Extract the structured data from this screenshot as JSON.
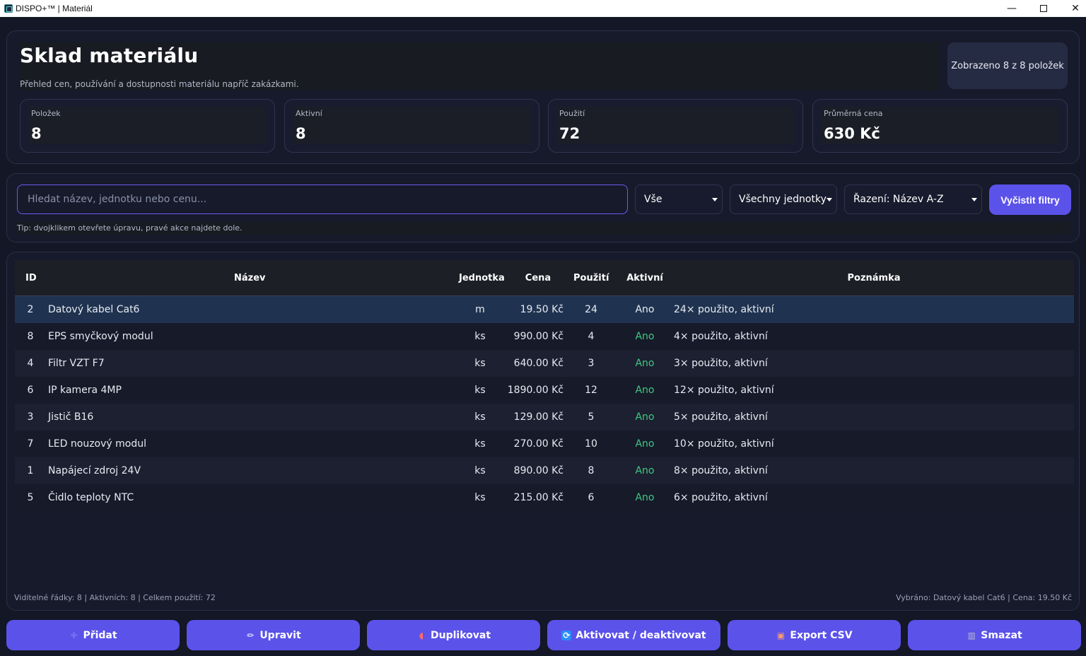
{
  "window": {
    "title": "DISPO+™ | Materiál"
  },
  "header": {
    "title": "Sklad materiálu",
    "subtitle": "Přehled cen, používání a dostupnosti materiálu napříč zakázkami.",
    "shown_badge": "Zobrazeno 8 z 8 položek",
    "stats": [
      {
        "label": "Položek",
        "value": "8"
      },
      {
        "label": "Aktivní",
        "value": "8"
      },
      {
        "label": "Použití",
        "value": "72"
      },
      {
        "label": "Průměrná cena",
        "value": "630 Kč"
      }
    ]
  },
  "filters": {
    "search_placeholder": "Hledat název, jednotku nebo cenu...",
    "search_value": "",
    "type_select": "Vše",
    "unit_select": "Všechny jednotky",
    "sort_select": "Řazení: Název A-Z",
    "clear_label": "Vyčistit filtry",
    "tip": "Tip: dvojklikem otevřete úpravu, pravé akce najdete dole."
  },
  "table": {
    "columns": [
      "ID",
      "Název",
      "Jednotka",
      "Cena",
      "Použití",
      "Aktivní",
      "Poznámka"
    ],
    "rows": [
      {
        "id": "2",
        "name": "Datový kabel Cat6",
        "unit": "m",
        "price": "19.50 Kč",
        "usage": "24",
        "active": "Ano",
        "note": "24× použito, aktivní"
      },
      {
        "id": "8",
        "name": "EPS smyčkový modul",
        "unit": "ks",
        "price": "990.00 Kč",
        "usage": "4",
        "active": "Ano",
        "note": "4× použito, aktivní"
      },
      {
        "id": "4",
        "name": "Filtr VZT F7",
        "unit": "ks",
        "price": "640.00 Kč",
        "usage": "3",
        "active": "Ano",
        "note": "3× použito, aktivní"
      },
      {
        "id": "6",
        "name": "IP kamera 4MP",
        "unit": "ks",
        "price": "1890.00 Kč",
        "usage": "12",
        "active": "Ano",
        "note": "12× použito, aktivní"
      },
      {
        "id": "3",
        "name": "Jistič B16",
        "unit": "ks",
        "price": "129.00 Kč",
        "usage": "5",
        "active": "Ano",
        "note": "5× použito, aktivní"
      },
      {
        "id": "7",
        "name": "LED nouzový modul",
        "unit": "ks",
        "price": "270.00 Kč",
        "usage": "10",
        "active": "Ano",
        "note": "10× použito, aktivní"
      },
      {
        "id": "1",
        "name": "Napájecí zdroj 24V",
        "unit": "ks",
        "price": "890.00 Kč",
        "usage": "8",
        "active": "Ano",
        "note": "8× použito, aktivní"
      },
      {
        "id": "5",
        "name": "Čidlo teploty NTC",
        "unit": "ks",
        "price": "215.00 Kč",
        "usage": "6",
        "active": "Ano",
        "note": "6× použito, aktivní"
      }
    ],
    "footer_left": "Viditelné řádky: 8 | Aktivních: 8 | Celkem použití: 72",
    "footer_right": "Vybráno: Datový kabel Cat6 | Cena: 19.50 Kč"
  },
  "actions": [
    {
      "label": "Přidat",
      "icon": "plus-icon"
    },
    {
      "label": "Upravit",
      "icon": "pencil-icon"
    },
    {
      "label": "Duplikovat",
      "icon": "magnet-icon"
    },
    {
      "label": "Aktivovat / deaktivovat",
      "icon": "cycle-icon"
    },
    {
      "label": "Export CSV",
      "icon": "package-icon"
    },
    {
      "label": "Smazat",
      "icon": "trash-icon"
    }
  ],
  "colors": {
    "background": "#141725",
    "panel": "#161a2b",
    "accent": "#5b52ea",
    "active_green": "#3fc983",
    "selected_row": "#1f3350"
  }
}
